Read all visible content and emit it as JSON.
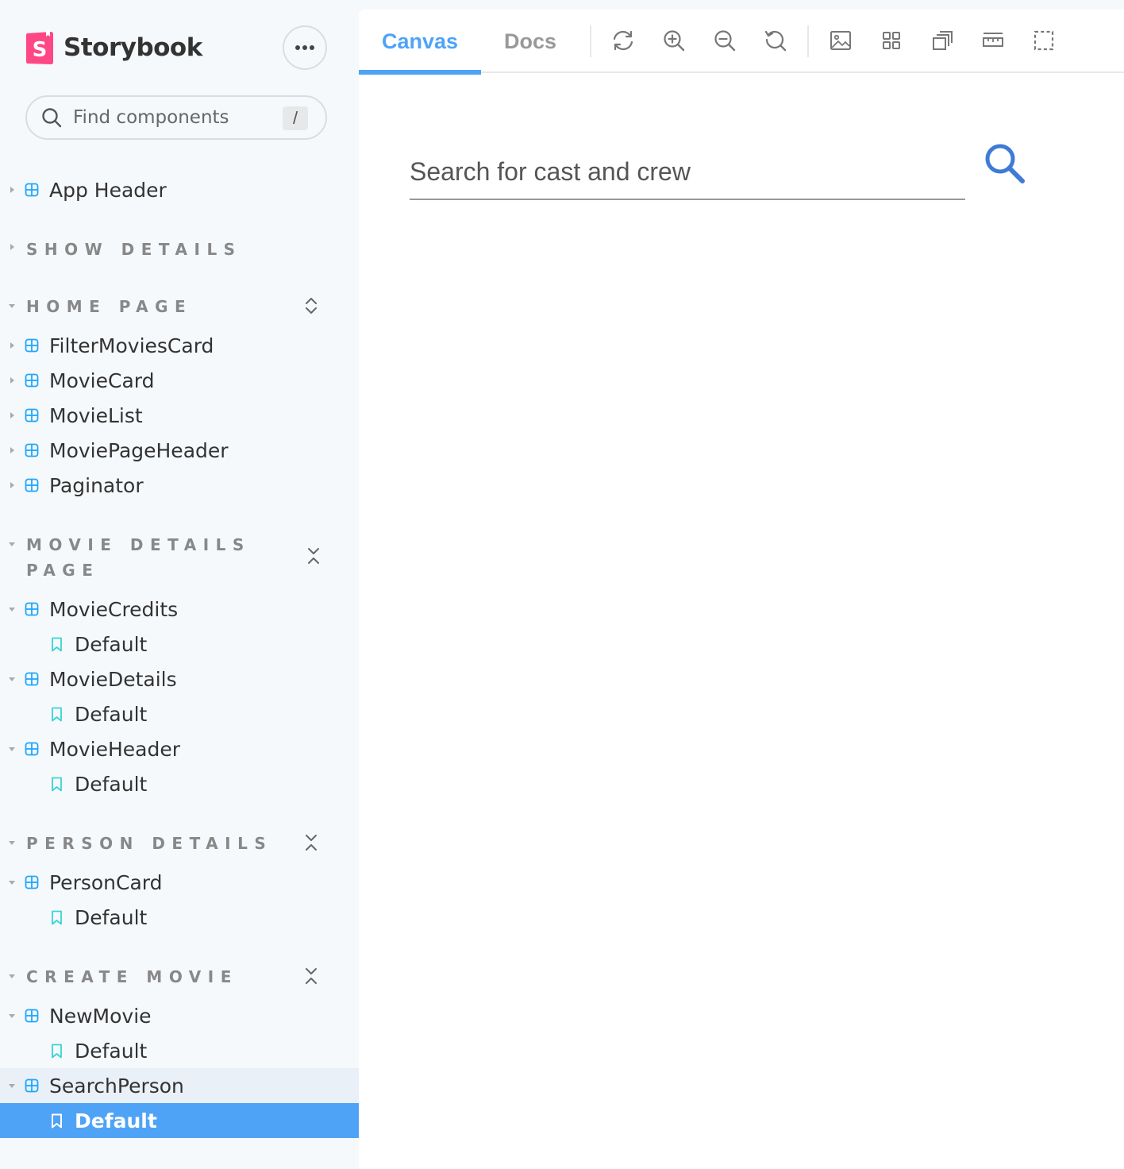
{
  "app": {
    "name": "Storybook",
    "accent": "#4fa3f7",
    "logo_color": "#ff4785"
  },
  "sidebar": {
    "search_placeholder": "Find components",
    "search_shortcut": "/",
    "items": [
      {
        "type": "component",
        "label": "App Header"
      },
      {
        "type": "group",
        "label": "SHOW DETAILS"
      },
      {
        "type": "group",
        "label": "HOME PAGE"
      },
      {
        "type": "component",
        "label": "FilterMoviesCard"
      },
      {
        "type": "component",
        "label": "MovieCard"
      },
      {
        "type": "component",
        "label": "MovieList"
      },
      {
        "type": "component",
        "label": "MoviePageHeader"
      },
      {
        "type": "component",
        "label": "Paginator"
      },
      {
        "type": "group",
        "label": "MOVIE DETAILS PAGE"
      },
      {
        "type": "component",
        "label": "MovieCredits"
      },
      {
        "type": "story",
        "label": "Default"
      },
      {
        "type": "component",
        "label": "MovieDetails"
      },
      {
        "type": "story",
        "label": "Default"
      },
      {
        "type": "component",
        "label": "MovieHeader"
      },
      {
        "type": "story",
        "label": "Default"
      },
      {
        "type": "group",
        "label": "PERSON DETAILS"
      },
      {
        "type": "component",
        "label": "PersonCard"
      },
      {
        "type": "story",
        "label": "Default"
      },
      {
        "type": "group",
        "label": "CREATE MOVIE"
      },
      {
        "type": "component",
        "label": "NewMovie"
      },
      {
        "type": "story",
        "label": "Default"
      },
      {
        "type": "component",
        "label": "SearchPerson"
      },
      {
        "type": "story",
        "label": "Default",
        "selected": true
      }
    ]
  },
  "toolbar": {
    "tabs": [
      {
        "label": "Canvas",
        "active": true
      },
      {
        "label": "Docs",
        "active": false
      }
    ],
    "tools": [
      "reload-icon",
      "zoom-in-icon",
      "zoom-out-icon",
      "reset-zoom-icon",
      "background-icon",
      "grid-icon",
      "viewport-icon",
      "measure-icon",
      "outline-icon"
    ]
  },
  "canvas": {
    "search_placeholder": "Search for cast and crew",
    "search_icon_color": "#3f7bd6"
  }
}
